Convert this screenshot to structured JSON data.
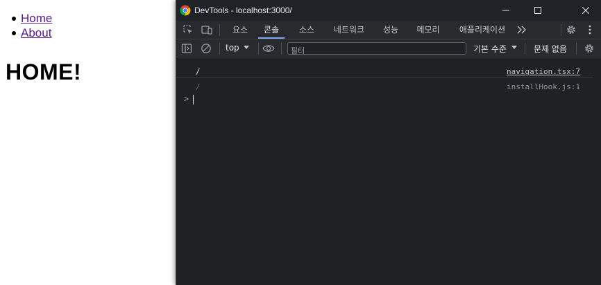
{
  "page": {
    "nav": [
      {
        "label": "Home"
      },
      {
        "label": "About"
      }
    ],
    "heading": "HOME!"
  },
  "devtools": {
    "window_title": "DevTools - localhost:3000/",
    "tabs": [
      "요소",
      "콘솔",
      "소스",
      "네트워크",
      "성능",
      "메모리",
      "애플리케이션"
    ],
    "active_tab": "콘솔",
    "more_tabs_icon": "chevron-double-right-icon",
    "toolbar": {
      "context": "top",
      "filter_placeholder": "필터",
      "levels": "기본 수준",
      "issues": "문제 없음"
    },
    "messages": [
      {
        "text": "/",
        "source": "navigation.tsx:7"
      },
      {
        "text": "/",
        "source": "installHook.js:1"
      }
    ],
    "prompt_symbol": ">"
  },
  "colors": {
    "devtools_bg": "#202124",
    "titlebar_bg": "#1f2328",
    "accent": "#7cacf8",
    "link": "#551a8b"
  }
}
